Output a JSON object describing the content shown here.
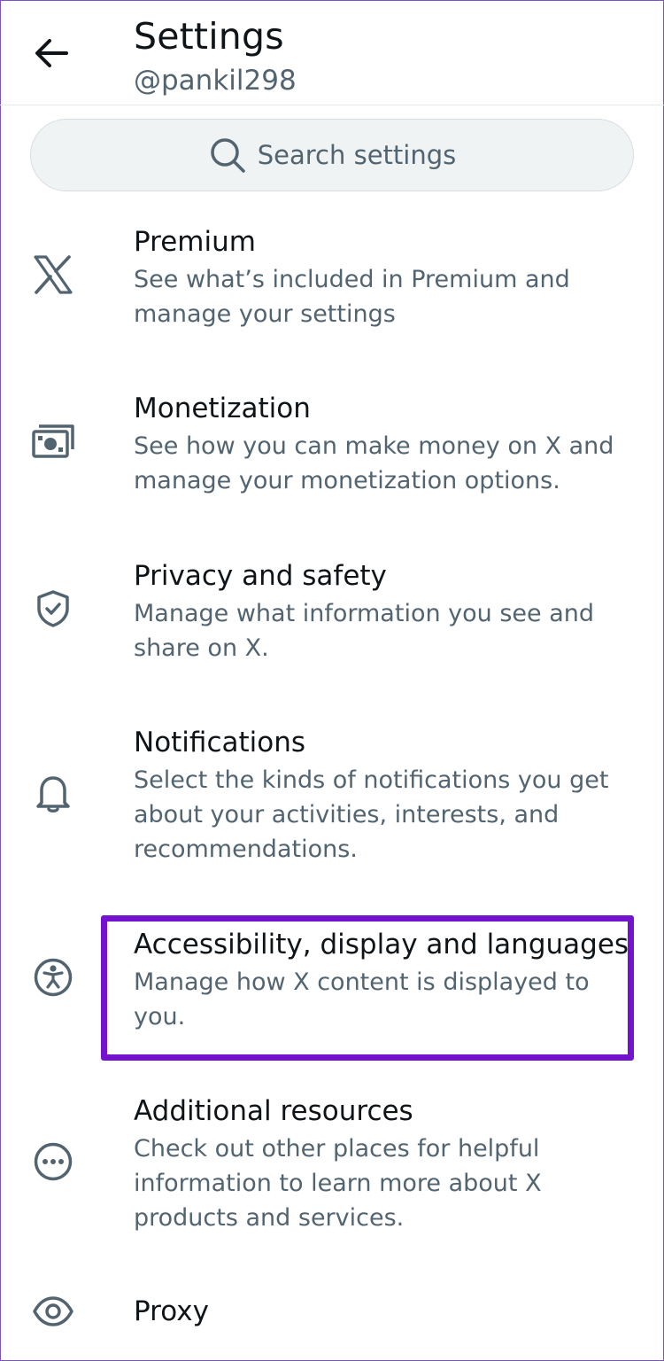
{
  "header": {
    "title": "Settings",
    "username": "@pankil298"
  },
  "search": {
    "placeholder": "Search settings"
  },
  "items": [
    {
      "title": "Premium",
      "desc": "See what’s included in Premium and manage your settings",
      "icon": "x-logo-icon"
    },
    {
      "title": "Monetization",
      "desc": "See how you can make money on X and manage your monetization options.",
      "icon": "money-icon"
    },
    {
      "title": "Privacy and safety",
      "desc": "Manage what information you see and share on X.",
      "icon": "shield-icon"
    },
    {
      "title": "Notifications",
      "desc": "Select the kinds of notifications you get about your activities, interests, and recommendations.",
      "icon": "bell-icon"
    },
    {
      "title": "Accessibility, display and languages",
      "desc": "Manage how X content is displayed to you.",
      "icon": "accessibility-icon"
    },
    {
      "title": "Additional resources",
      "desc": "Check out other places for helpful information to learn more about X products and services.",
      "icon": "more-icon"
    },
    {
      "title": "Proxy",
      "desc": "",
      "icon": "eye-icon"
    }
  ],
  "colors": {
    "text_primary": "#0f1419",
    "text_secondary": "#536471",
    "search_bg": "#eff3f4",
    "highlight": "#7413cf"
  }
}
